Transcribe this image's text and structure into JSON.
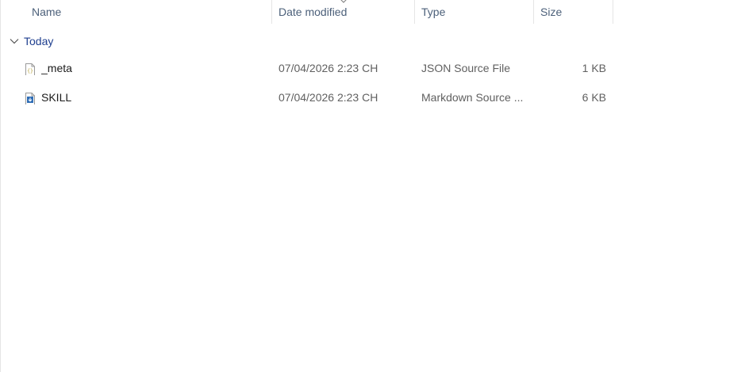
{
  "columns": {
    "name": "Name",
    "date": "Date modified",
    "type": "Type",
    "size": "Size"
  },
  "group": {
    "label": "Today"
  },
  "files": [
    {
      "name": "_meta",
      "date": "07/04/2026 2:23 CH",
      "type": "JSON Source File",
      "size": "1 KB",
      "icon": "json-file-icon"
    },
    {
      "name": "SKILL",
      "date": "07/04/2026 2:23 CH",
      "type": "Markdown Source ...",
      "size": "6 KB",
      "icon": "markdown-file-icon"
    }
  ],
  "colors": {
    "header_text": "#4c607a",
    "group_text": "#1f3f8f",
    "json_icon": "#b5a13a",
    "markdown_icon": "#2f6db5"
  }
}
